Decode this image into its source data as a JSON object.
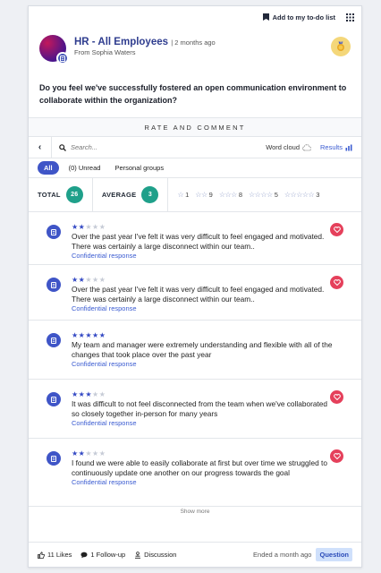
{
  "topbar": {
    "todo_label": "Add to my to-do list"
  },
  "post": {
    "group": "HR - All Employees",
    "time": "| 2 months ago",
    "from": "From Sophia Waters",
    "question": "Do you feel we've successfully fostered an open communication environment to collaborate within the organization?"
  },
  "section_title": "RATE AND COMMENT",
  "toolbar": {
    "search_placeholder": "Search...",
    "word_cloud": "Word cloud",
    "results": "Results"
  },
  "filters": [
    "All",
    "(0) Unread",
    "Personal groups"
  ],
  "stats": {
    "total_label": "TOTAL",
    "total_value": "26",
    "average_label": "AVERAGE",
    "average_value": "3",
    "distribution": [
      {
        "stars": 1,
        "count": "1"
      },
      {
        "stars": 2,
        "count": "9"
      },
      {
        "stars": 3,
        "count": "8"
      },
      {
        "stars": 4,
        "count": "5"
      },
      {
        "stars": 5,
        "count": "3"
      }
    ]
  },
  "responses": [
    {
      "rating": 2,
      "text": "Over the past year I've felt it was very difficult to feel engaged and motivated. There was certainly a large disconnect within our team..",
      "conf": "Confidential response",
      "liked": true
    },
    {
      "rating": 2,
      "text": "Over the past year I've felt it was very difficult to feel engaged and motivated. There was certainly a large disconnect within our team..",
      "conf": "Confidential response",
      "liked": true
    },
    {
      "rating": 5,
      "text": "My team and manager were extremely understanding and flexible with all of the changes that took place over the past year",
      "conf": "Confidential response",
      "liked": false
    },
    {
      "rating": 3,
      "text": "It was difficult to not feel disconnected from the team when we've collaborated so closely together in-person for many years",
      "conf": "Confidential response",
      "liked": true
    },
    {
      "rating": 2,
      "text": "I found we were able to easily collaborate at first but over time we struggled to continuously update one another on our progress towards the goal",
      "conf": "Confidential response",
      "liked": true
    }
  ],
  "show_more": "Show more",
  "footer": {
    "likes": "11 Likes",
    "followups": "1 Follow-up",
    "discussion": "Discussion",
    "ended": "Ended a month ago",
    "badge": "Question"
  },
  "colors": {
    "accent": "#3f55c7",
    "teal": "#1fa08a",
    "heart": "#e5405b"
  }
}
